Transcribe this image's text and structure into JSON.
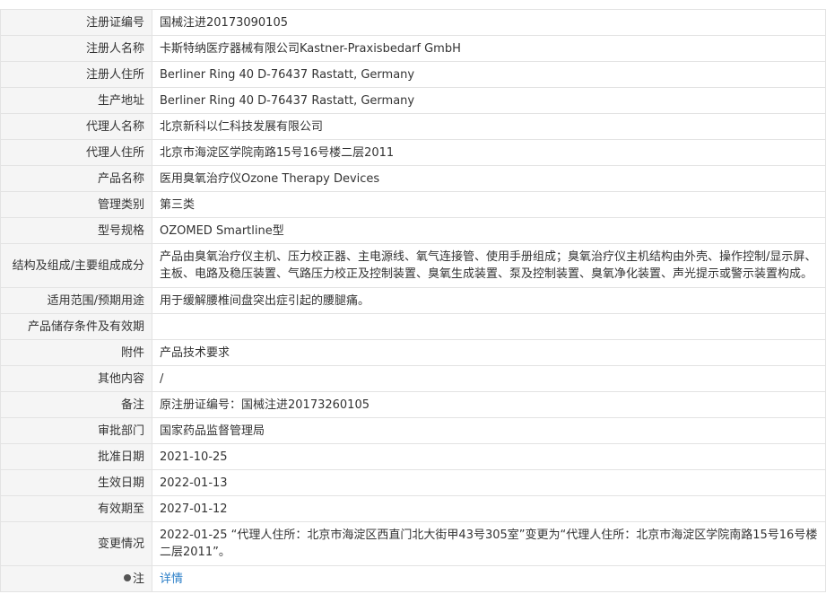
{
  "rows": [
    {
      "label": "注册证编号",
      "value": "国械注进20173090105"
    },
    {
      "label": "注册人名称",
      "value": "卡斯特纳医疗器械有限公司Kastner-Praxisbedarf GmbH"
    },
    {
      "label": "注册人住所",
      "value": "Berliner Ring 40 D-76437 Rastatt, Germany"
    },
    {
      "label": "生产地址",
      "value": "Berliner Ring 40 D-76437 Rastatt, Germany"
    },
    {
      "label": "代理人名称",
      "value": "北京新科以仁科技发展有限公司"
    },
    {
      "label": "代理人住所",
      "value": "北京市海淀区学院南路15号16号楼二层2011"
    },
    {
      "label": "产品名称",
      "value": "医用臭氧治疗仪Ozone Therapy Devices"
    },
    {
      "label": "管理类别",
      "value": "第三类"
    },
    {
      "label": "型号规格",
      "value": "OZOMED Smartline型"
    },
    {
      "label": "结构及组成/主要组成成分",
      "value": "产品由臭氧治疗仪主机、压力校正器、主电源线、氧气连接管、使用手册组成；臭氧治疗仪主机结构由外壳、操作控制/显示屏、主板、电路及稳压装置、气路压力校正及控制装置、臭氧生成装置、泵及控制装置、臭氧净化装置、声光提示或警示装置构成。"
    },
    {
      "label": "适用范围/预期用途",
      "value": "用于缓解腰椎间盘突出症引起的腰腿痛。"
    },
    {
      "label": "产品储存条件及有效期",
      "value": ""
    },
    {
      "label": "附件",
      "value": "产品技术要求"
    },
    {
      "label": "其他内容",
      "value": "/"
    },
    {
      "label": "备注",
      "value": "原注册证编号：国械注进20173260105"
    },
    {
      "label": "审批部门",
      "value": "国家药品监督管理局"
    },
    {
      "label": "批准日期",
      "value": "2021-10-25"
    },
    {
      "label": "生效日期",
      "value": "2022-01-13"
    },
    {
      "label": "有效期至",
      "value": "2027-01-12"
    },
    {
      "label": "变更情况",
      "value": "2022-01-25 “代理人住所：北京市海淀区西直门北大街甲43号305室”变更为“代理人住所：北京市海淀区学院南路15号16号楼二层2011”。"
    }
  ],
  "note": {
    "label": "注",
    "link": "详情",
    "icon": "dot-icon"
  }
}
